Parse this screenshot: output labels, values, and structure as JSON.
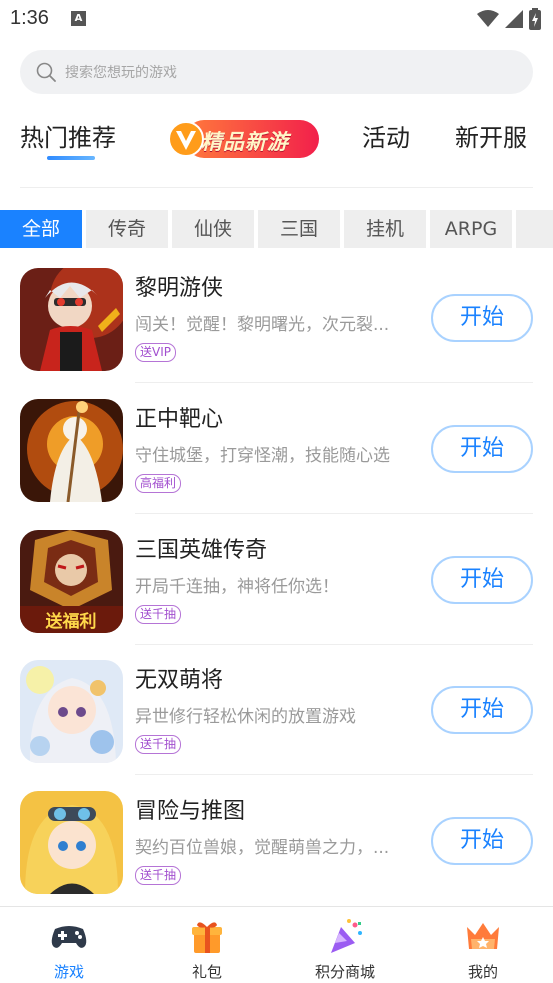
{
  "status_bar": {
    "time": "1:36",
    "notification_glyph": "A"
  },
  "search": {
    "placeholder": "搜索您想玩的游戏"
  },
  "top_tabs": [
    {
      "label": "热门推荐",
      "active": true
    },
    {
      "label": "精品新游",
      "active": false
    },
    {
      "label": "活动",
      "active": false
    },
    {
      "label": "新开服",
      "active": false
    }
  ],
  "categories": [
    {
      "label": "全部",
      "active": true
    },
    {
      "label": "传奇",
      "active": false
    },
    {
      "label": "仙侠",
      "active": false
    },
    {
      "label": "三国",
      "active": false
    },
    {
      "label": "挂机",
      "active": false
    },
    {
      "label": "ARPG",
      "active": false
    }
  ],
  "games": [
    {
      "name": "黎明游侠",
      "desc": "闯关！觉醒！黎明曙光，次元裂...",
      "tag": "送VIP",
      "button": "开始"
    },
    {
      "name": "正中靶心",
      "desc": "守住城堡，打穿怪潮，技能随心选",
      "tag": "高福利",
      "button": "开始"
    },
    {
      "name": "三国英雄传奇",
      "desc": "开局千连抽，神将任你选！",
      "tag": "送千抽",
      "button": "开始",
      "thumb_text": "送福利"
    },
    {
      "name": "无双萌将",
      "desc": "异世修行轻松休闲的放置游戏",
      "tag": "送千抽",
      "button": "开始"
    },
    {
      "name": "冒险与推图",
      "desc": "契约百位兽娘，觉醒萌兽之力，...",
      "tag": "送千抽",
      "button": "开始"
    }
  ],
  "bottom_nav": [
    {
      "label": "游戏",
      "icon": "gamepad-icon",
      "active": true
    },
    {
      "label": "礼包",
      "icon": "gift-icon",
      "active": false
    },
    {
      "label": "积分商城",
      "icon": "party-popper-icon",
      "active": false
    },
    {
      "label": "我的",
      "icon": "crown-icon",
      "active": false
    }
  ],
  "colors": {
    "accent": "#1a82ff",
    "tag_purple": "#a24fcf",
    "badge_red": "#f2204b"
  }
}
